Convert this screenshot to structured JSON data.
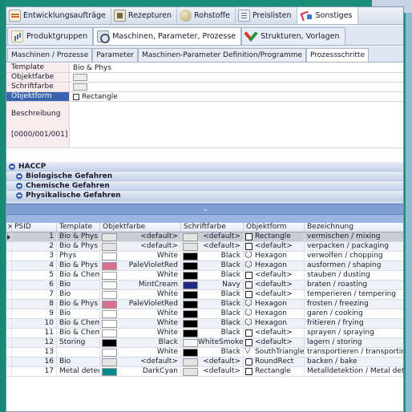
{
  "colors": {
    "accent": "#3a63b0",
    "selection": "#d9e2f3",
    "header_bg": "#dfe6f1"
  },
  "main_tabs": [
    {
      "label": "Entwicklungsaufträge",
      "icon": "document-icon"
    },
    {
      "label": "Rezepturen",
      "icon": "recipe-icon"
    },
    {
      "label": "Rohstoffe",
      "icon": "ingredient-ball-icon"
    },
    {
      "label": "Preislisten",
      "icon": "list-icon"
    },
    {
      "label": "Sonstiges",
      "icon": "fork-icon",
      "active": true
    }
  ],
  "sub_tabs": [
    {
      "label": "Produktgruppen",
      "icon": "bar-chart-icon"
    },
    {
      "label": "Maschinen, Parameter, Prozesse",
      "icon": "machine-icon",
      "active": true
    },
    {
      "label": "Strukturen, Vorlagen",
      "icon": "tools-icon"
    }
  ],
  "third_tabs": [
    {
      "label": "Maschinen / Prozesse"
    },
    {
      "label": "Parameter"
    },
    {
      "label": "Maschinen-Parameter Definition/Programme"
    },
    {
      "label": "Prozessschritte",
      "active": true
    }
  ],
  "form": {
    "template_label": "Template",
    "template_value": "Bio & Phys",
    "objektfarbe_label": "Objektfarbe",
    "schriftfarbe_label": "Schriftfarbe",
    "objektform_label": "Objektform",
    "objektform_value": "Rectangle",
    "beschreibung_label": "Beschreibung",
    "code_label": "[0000/001/001]"
  },
  "haccp": {
    "title": "HACCP",
    "items": [
      "Biologische Gefahren",
      "Chemische Gefahren",
      "Physikalische Gefahren"
    ]
  },
  "splitter_glyph": "⌄",
  "grid": {
    "headers": [
      "PSID",
      "Template",
      "Objektfarbe",
      "Schriftfarbe",
      "Objektform",
      "Bezeichnung"
    ],
    "rows": [
      {
        "psid": "1",
        "template": "Bio & Phys",
        "objektfarbe": "<default>",
        "of_color": "#e4e4e4",
        "schriftfarbe": "<default>",
        "sf_color": "#e4e4e4",
        "form": "Rectangle",
        "shape": "rect",
        "bezeichnung": "vermischen / mixing",
        "current": true
      },
      {
        "psid": "2",
        "template": "Bio & Phys",
        "objektfarbe": "<default>",
        "of_color": "#e4e4e4",
        "schriftfarbe": "<default>",
        "sf_color": "#e4e4e4",
        "form": "<default>",
        "shape": "rect",
        "bezeichnung": "verpacken / packaging"
      },
      {
        "psid": "3",
        "template": "Phys",
        "objektfarbe": "White",
        "of_color": "#ffffff",
        "schriftfarbe": "Black",
        "sf_color": "#000000",
        "form": "Hexagon",
        "shape": "hex",
        "bezeichnung": "verwolfen / chopping"
      },
      {
        "psid": "4",
        "template": "Bio & Phys",
        "objektfarbe": "PaleVioletRed",
        "of_color": "#db7093",
        "schriftfarbe": "Black",
        "sf_color": "#000000",
        "form": "Hexagon",
        "shape": "hex",
        "bezeichnung": "ausformen / shaping"
      },
      {
        "psid": "5",
        "template": "Bio & Chem",
        "objektfarbe": "White",
        "of_color": "#ffffff",
        "schriftfarbe": "Black",
        "sf_color": "#000000",
        "form": "<default>",
        "shape": "rect",
        "bezeichnung": "stauben / dusting"
      },
      {
        "psid": "6",
        "template": "Bio",
        "objektfarbe": "MintCream",
        "of_color": "#f5fffa",
        "schriftfarbe": "Navy",
        "sf_color": "#1c2a80",
        "form": "<default>",
        "shape": "rect",
        "bezeichnung": "braten / roasting"
      },
      {
        "psid": "7",
        "template": "Bio",
        "objektfarbe": "White",
        "of_color": "#ffffff",
        "schriftfarbe": "Black",
        "sf_color": "#000000",
        "form": "<default>",
        "shape": "rect",
        "bezeichnung": "temperieren / tempering"
      },
      {
        "psid": "8",
        "template": "Bio & Phys",
        "objektfarbe": "PaleVioletRed",
        "of_color": "#db7093",
        "schriftfarbe": "Black",
        "sf_color": "#000000",
        "form": "Hexagon",
        "shape": "hex",
        "bezeichnung": "frosten / freezing"
      },
      {
        "psid": "9",
        "template": "Bio",
        "objektfarbe": "White",
        "of_color": "#ffffff",
        "schriftfarbe": "Black",
        "sf_color": "#000000",
        "form": "Hexagon",
        "shape": "hex",
        "bezeichnung": "garen / cooking"
      },
      {
        "psid": "10",
        "template": "Bio & Chem",
        "objektfarbe": "White",
        "of_color": "#ffffff",
        "schriftfarbe": "Black",
        "sf_color": "#000000",
        "form": "Hexagon",
        "shape": "hex",
        "bezeichnung": "fritieren / frying"
      },
      {
        "psid": "11",
        "template": "Bio & Chem",
        "objektfarbe": "White",
        "of_color": "#ffffff",
        "schriftfarbe": "Black",
        "sf_color": "#000000",
        "form": "<default>",
        "shape": "rect",
        "bezeichnung": "sprayen / spraying"
      },
      {
        "psid": "12",
        "template": "Storing",
        "objektfarbe": "Black",
        "of_color": "#000000",
        "schriftfarbe": "WhiteSmoke",
        "sf_color": "#f5f5f5",
        "form": "<default>",
        "shape": "rect",
        "bezeichnung": "lagern / storing"
      },
      {
        "psid": "13",
        "template": "",
        "objektfarbe": "White",
        "of_color": "#ffffff",
        "schriftfarbe": "Black",
        "sf_color": "#000000",
        "form": "SouthTriangle",
        "shape": "tri",
        "bezeichnung": "transportieren / transporting"
      },
      {
        "psid": "16",
        "template": "Bio",
        "objektfarbe": "<default>",
        "of_color": "#e4e4e4",
        "schriftfarbe": "<default>",
        "sf_color": "#e4e4e4",
        "form": "RoundRect",
        "shape": "rrect",
        "bezeichnung": "backen / bake"
      },
      {
        "psid": "17",
        "template": "Metal detect",
        "objektfarbe": "DarkCyan",
        "of_color": "#008b8b",
        "schriftfarbe": "<default>",
        "sf_color": "#e4e4e4",
        "form": "Rectangle",
        "shape": "rect",
        "bezeichnung": "Metalldetektion / Metal detection"
      }
    ]
  }
}
